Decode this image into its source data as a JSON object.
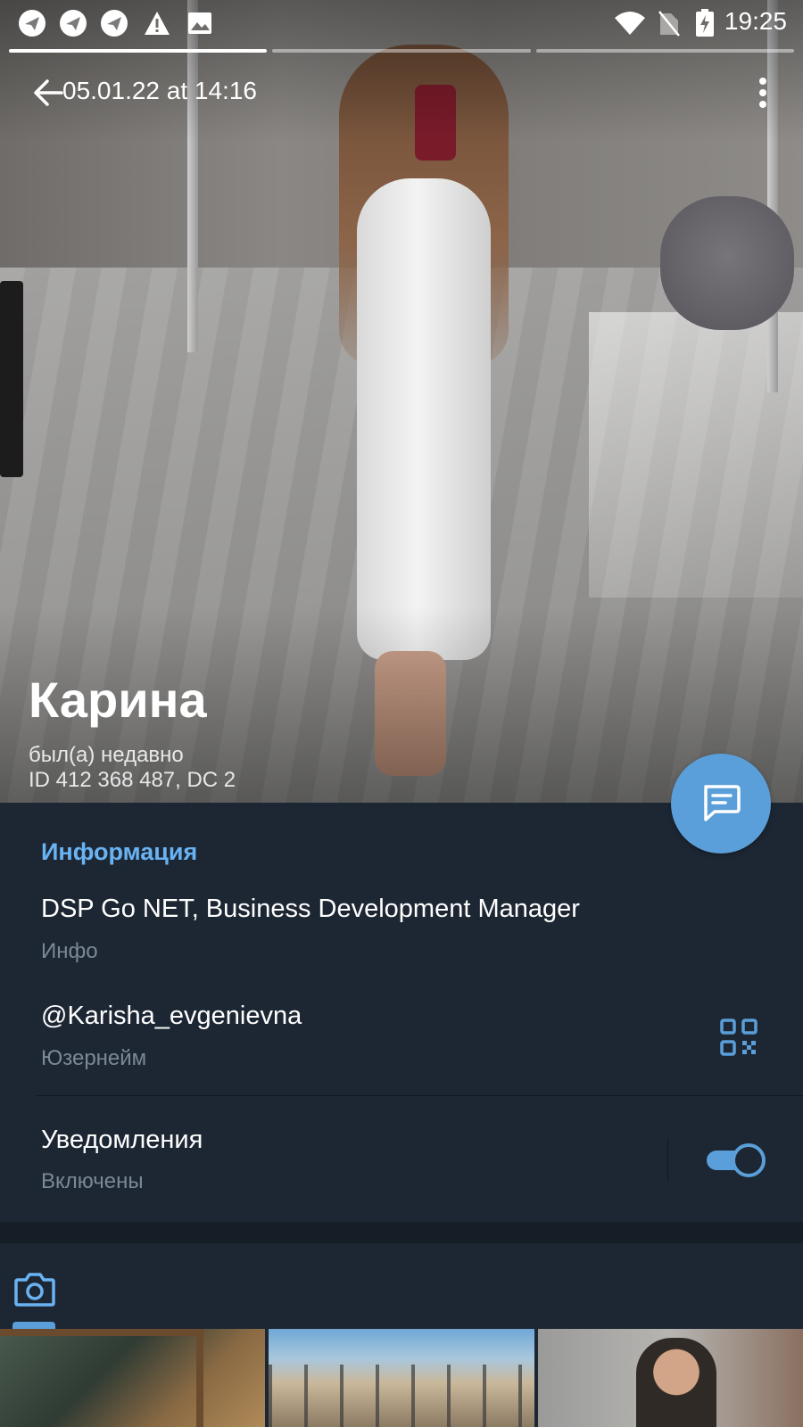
{
  "status_bar": {
    "time": "19:25",
    "left_icons": [
      "telegram-notification-icon",
      "telegram-notification-icon",
      "telegram-notification-icon",
      "warning-icon",
      "image-icon"
    ],
    "right_icons": [
      "wifi-icon",
      "no-sim-icon",
      "battery-charging-icon"
    ]
  },
  "story_progress": {
    "segments": 3,
    "active_index": 0
  },
  "toolbar": {
    "photo_date": "05.01.22 at 14:16",
    "back_icon": "arrow-back-icon",
    "more_icon": "more-vertical-icon"
  },
  "profile": {
    "name": "Карина",
    "last_seen": "был(а) недавно",
    "id_line": "ID 412 368 487, DC 2"
  },
  "fab": {
    "icon": "message-icon"
  },
  "info": {
    "section_title": "Информация",
    "bio_value": "DSP Go NET, Business Development Manager",
    "bio_label": "Инфо",
    "username_value": "@Karisha_evgenievna",
    "username_label": "Юзернейм",
    "notifications_value": "Уведомления",
    "notifications_label": "Включены",
    "notifications_enabled": true
  },
  "media": {
    "active_tab_icon": "camera-icon",
    "thumbnails": [
      "photo-thumbnail",
      "photo-thumbnail",
      "photo-thumbnail"
    ]
  },
  "colors": {
    "accent": "#6ab3f3",
    "fab": "#5a9fd9",
    "background": "#1d2733",
    "secondary_text": "#7b8995"
  }
}
